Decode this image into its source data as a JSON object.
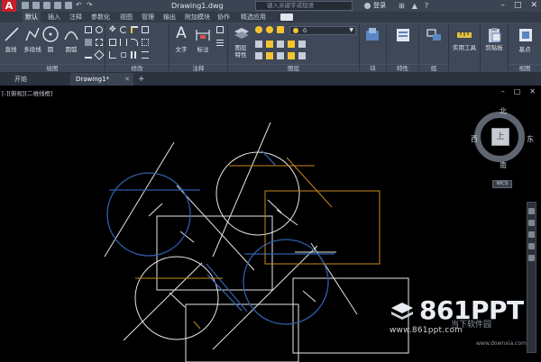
{
  "titlebar": {
    "app_logo": "A",
    "document_title": "Drawing1.dwg",
    "search_placeholder": "键入关键字或短语",
    "login_label": "登录",
    "help_label": "?"
  },
  "ribbon_tabs": [
    {
      "label": "默认",
      "active": true
    },
    {
      "label": "插入"
    },
    {
      "label": "注释"
    },
    {
      "label": "参数化"
    },
    {
      "label": "视图"
    },
    {
      "label": "管理"
    },
    {
      "label": "输出"
    },
    {
      "label": "附加模块"
    },
    {
      "label": "协作"
    },
    {
      "label": "精选应用"
    }
  ],
  "ribbon": {
    "draw": {
      "title": "绘图",
      "line_label": "直线",
      "polyline_label": "多段线",
      "circle_label": "圆",
      "arc_label": "圆弧"
    },
    "modify": {
      "title": "修改"
    },
    "annotation": {
      "title": "注释",
      "text_label": "文字",
      "dimension_label": "标注"
    },
    "layers": {
      "title": "图层",
      "properties_label": "图层\n特性",
      "current_layer": "0"
    },
    "block": {
      "title": "块"
    },
    "properties": {
      "title": "特性"
    },
    "groups": {
      "title": "组"
    },
    "utilities": {
      "title": "实用工具"
    },
    "clipboard": {
      "title": "剪贴板"
    },
    "view": {
      "title": "视图",
      "base_label": "基点"
    }
  },
  "file_tabs": [
    {
      "label": "开始"
    },
    {
      "label": "Drawing1*",
      "active": true
    }
  ],
  "new_tab_label": "+",
  "viewport": {
    "label": "[-][俯视][二维线框]",
    "viewcube": {
      "north": "北",
      "south": "南",
      "east": "东",
      "west": "西",
      "face": "上",
      "wcs": "WCS"
    }
  },
  "watermark": {
    "brand": "861PPT",
    "site": "www.861ppt.com",
    "sub_text": "当下软件园",
    "sub_url": "www.downxia.com"
  },
  "colors": {
    "canvas_bg": "#000000",
    "ribbon_bg": "#3f4858",
    "white_geometry": "#e6e6e6",
    "blue_geometry": "#2e5ea8",
    "orange_geometry": "#c8871e",
    "app_red": "#c8202a"
  }
}
